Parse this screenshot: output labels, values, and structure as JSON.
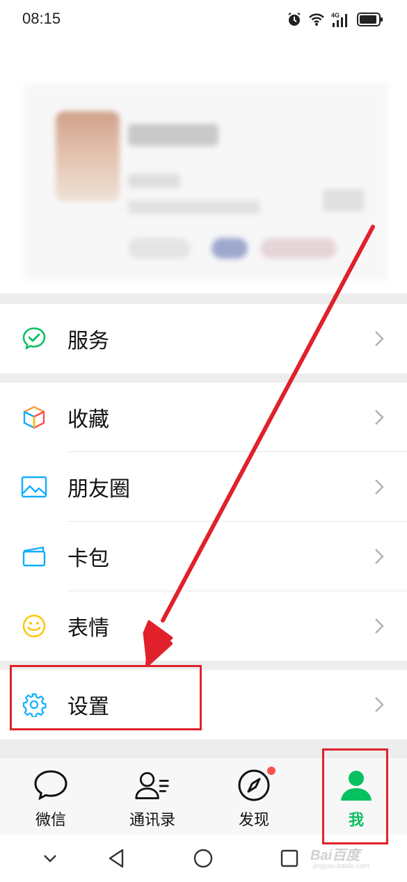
{
  "status_bar": {
    "time": "08:15",
    "icons": [
      "alarm-icon",
      "wifi-icon",
      "4g-signal-icon",
      "battery-icon"
    ],
    "network": "4G"
  },
  "profile": {
    "blurred": true
  },
  "menu": {
    "service": {
      "label": "服务",
      "icon": "service-icon"
    },
    "favorites": {
      "label": "收藏",
      "icon": "favorites-cube-icon"
    },
    "moments": {
      "label": "朋友圈",
      "icon": "moments-picture-icon"
    },
    "cards": {
      "label": "卡包",
      "icon": "card-wallet-icon"
    },
    "stickers": {
      "label": "表情",
      "icon": "smiley-icon"
    },
    "settings": {
      "label": "设置",
      "icon": "gear-icon"
    }
  },
  "tabs": [
    {
      "label": "微信",
      "icon": "chat-bubble-icon",
      "active": false
    },
    {
      "label": "通讯录",
      "icon": "contacts-icon",
      "active": false
    },
    {
      "label": "发现",
      "icon": "compass-icon",
      "active": false,
      "badge": "red-dot"
    },
    {
      "label": "我",
      "icon": "person-icon",
      "active": true
    }
  ],
  "colors": {
    "accent_green": "#07c160",
    "annotation_red": "#e0212b",
    "badge_red": "#fa5151"
  },
  "watermark": {
    "brand": "Bai百度",
    "sub": "jingyan.baidu.com"
  }
}
